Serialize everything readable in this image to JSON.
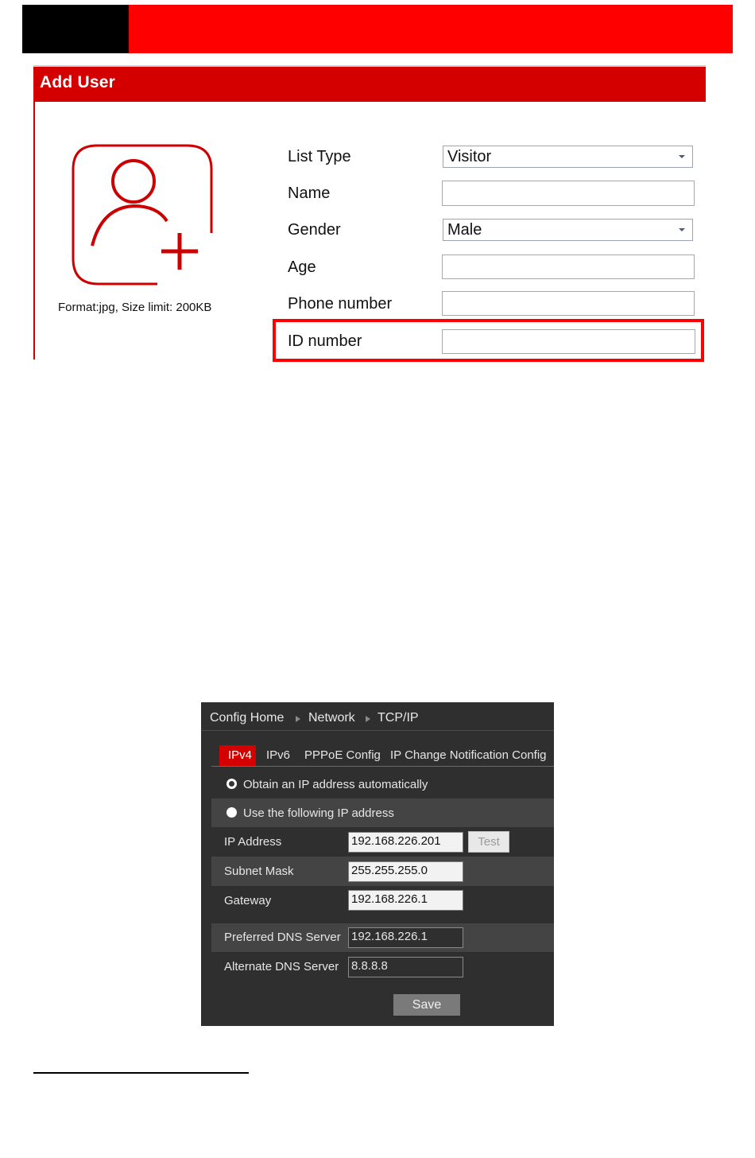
{
  "colors": {
    "accent_red": "#d40000",
    "banner_red": "#ff0000",
    "dark_panel": "#2f2f2f"
  },
  "add_user": {
    "title": "Add User",
    "photo_icon": "add-user-icon",
    "photo_hint": "Format:jpg, Size limit: 200KB",
    "fields": {
      "list_type": {
        "label": "List Type",
        "value": "Visitor"
      },
      "name": {
        "label": "Name",
        "value": ""
      },
      "gender": {
        "label": "Gender",
        "value": "Male"
      },
      "age": {
        "label": "Age",
        "value": ""
      },
      "phone": {
        "label": "Phone number",
        "value": ""
      },
      "id_number": {
        "label": "ID number",
        "value": ""
      }
    }
  },
  "tcpip": {
    "breadcrumb": [
      "Config Home",
      "Network",
      "TCP/IP"
    ],
    "tabs": [
      "IPv4",
      "IPv6",
      "PPPoE Config",
      "IP Change Notification Config"
    ],
    "active_tab": "IPv4",
    "radio_auto": "Obtain an IP address automatically",
    "radio_manual": "Use the following IP address",
    "ip_address": {
      "label": "IP Address",
      "value": "192.168.226.201"
    },
    "test_label": "Test",
    "subnet_mask": {
      "label": "Subnet Mask",
      "value": "255.255.255.0"
    },
    "gateway": {
      "label": "Gateway",
      "value": "192.168.226.1"
    },
    "preferred_dns": {
      "label": "Preferred DNS Server",
      "value": "192.168.226.1"
    },
    "alternate_dns": {
      "label": "Alternate DNS Server",
      "value": "8.8.8.8"
    },
    "save_label": "Save"
  }
}
